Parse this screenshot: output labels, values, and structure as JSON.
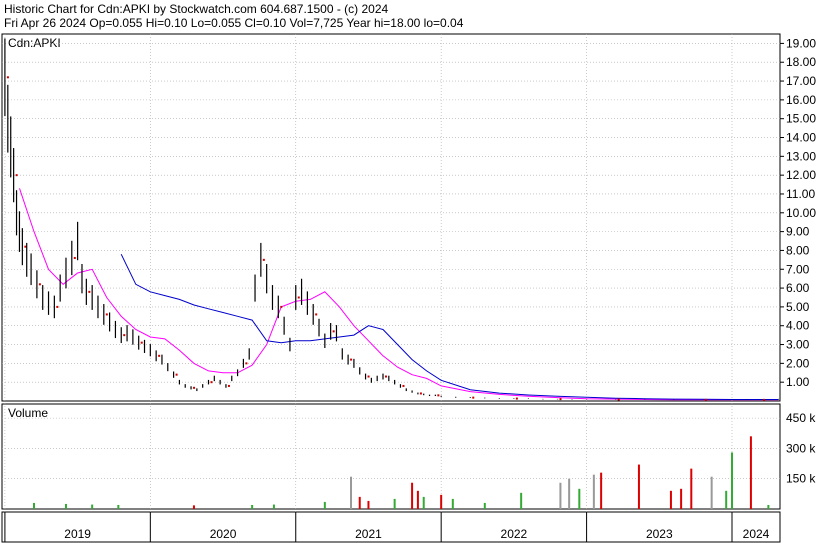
{
  "header": {
    "title_line": "Historic Chart for Cdn:APKI by Stockwatch.com 604.687.1500 - (c) 2024",
    "quote_line": "Fri Apr 26 2024   Op=0.055  Hi=0.10  Lo=0.055  Cl=0.10  Vol=7,725  Year hi=18.00  lo=0.04"
  },
  "price_panel": {
    "symbol_label": "Cdn:APKI"
  },
  "volume_panel": {
    "label": "Volume"
  },
  "colors": {
    "price_bars": "#000000",
    "ma_short": "#ff00ff",
    "ma_long": "#0000cc",
    "dots": "#cc0000",
    "vol_up": "#33aa33",
    "vol_down": "#dd0000",
    "vol_neutral": "#999999",
    "grid": "#aaaaaa"
  },
  "chart_data": [
    {
      "type": "line",
      "name": "price",
      "x_ticks": [
        "2019",
        "2020",
        "2021",
        "2022",
        "2023",
        "2024"
      ],
      "y_ticks": [
        "1.00",
        "2.00",
        "3.00",
        "4.00",
        "5.00",
        "6.00",
        "7.00",
        "8.00",
        "9.00",
        "10.00",
        "11.00",
        "12.00",
        "13.00",
        "14.00",
        "15.00",
        "16.00",
        "17.00",
        "18.00",
        "19.00"
      ],
      "ylim": [
        0,
        19.5
      ],
      "xlim": [
        2018.98,
        2024.33
      ],
      "series": [
        {
          "role": "price",
          "x": [
            2019.0,
            2019.02,
            2019.04,
            2019.06,
            2019.08,
            2019.1,
            2019.12,
            2019.15,
            2019.18,
            2019.22,
            2019.26,
            2019.3,
            2019.34,
            2019.38,
            2019.42,
            2019.46,
            2019.5,
            2019.53,
            2019.56,
            2019.6,
            2019.64,
            2019.68,
            2019.72,
            2019.76,
            2019.8,
            2019.84,
            2019.88,
            2019.92,
            2019.96,
            2020.0,
            2020.04,
            2020.08,
            2020.12,
            2020.16,
            2020.2,
            2020.24,
            2020.28,
            2020.32,
            2020.36,
            2020.4,
            2020.44,
            2020.48,
            2020.52,
            2020.56,
            2020.6,
            2020.64,
            2020.68,
            2020.72,
            2020.76,
            2020.8,
            2020.84,
            2020.88,
            2020.92,
            2020.96,
            2021.0,
            2021.04,
            2021.08,
            2021.12,
            2021.16,
            2021.2,
            2021.24,
            2021.28,
            2021.32,
            2021.36,
            2021.4,
            2021.44,
            2021.48,
            2021.52,
            2021.56,
            2021.6,
            2021.64,
            2021.68,
            2021.72,
            2021.76,
            2021.8,
            2021.84,
            2021.88,
            2021.92,
            2021.96,
            2022.0,
            2022.1,
            2022.2,
            2022.3,
            2022.4,
            2022.5,
            2022.6,
            2022.7,
            2022.8,
            2022.9,
            2023.0,
            2023.2,
            2023.4,
            2023.6,
            2023.8,
            2024.0,
            2024.1,
            2024.2,
            2024.32
          ],
          "y": [
            17.2,
            15.0,
            13.5,
            12.0,
            10.0,
            9.0,
            8.2,
            7.5,
            7.0,
            6.2,
            5.5,
            5.2,
            5.0,
            6.0,
            6.8,
            7.6,
            8.5,
            6.5,
            5.8,
            5.5,
            5.0,
            4.6,
            4.2,
            3.8,
            3.5,
            3.6,
            3.4,
            3.1,
            2.9,
            2.7,
            2.4,
            2.2,
            1.8,
            1.4,
            1.0,
            0.8,
            0.7,
            0.6,
            0.8,
            1.0,
            1.2,
            1.0,
            0.8,
            1.2,
            1.5,
            2.0,
            2.5,
            6.0,
            7.5,
            6.5,
            5.5,
            5.0,
            4.0,
            3.0,
            5.5,
            5.8,
            5.2,
            4.6,
            3.9,
            3.2,
            3.7,
            3.6,
            2.5,
            2.2,
            2.0,
            1.6,
            1.3,
            1.1,
            1.2,
            1.3,
            1.2,
            1.0,
            0.8,
            0.6,
            0.5,
            0.4,
            0.35,
            0.3,
            0.3,
            0.25,
            0.2,
            0.18,
            0.16,
            0.14,
            0.13,
            0.12,
            0.1,
            0.1,
            0.09,
            0.08,
            0.08,
            0.07,
            0.06,
            0.06,
            0.07,
            0.08,
            0.06,
            0.1
          ]
        },
        {
          "role": "ma_short",
          "x": [
            2019.1,
            2019.2,
            2019.3,
            2019.4,
            2019.5,
            2019.6,
            2019.7,
            2019.8,
            2019.9,
            2020.0,
            2020.1,
            2020.2,
            2020.3,
            2020.4,
            2020.5,
            2020.6,
            2020.7,
            2020.8,
            2020.9,
            2021.0,
            2021.1,
            2021.2,
            2021.3,
            2021.4,
            2021.5,
            2021.6,
            2021.7,
            2021.8,
            2021.9,
            2022.0,
            2022.2,
            2022.4,
            2022.6,
            2022.8,
            2023.0,
            2023.2,
            2023.4,
            2023.6,
            2023.8,
            2024.0,
            2024.2,
            2024.32
          ],
          "y": [
            11.3,
            9.0,
            7.0,
            6.2,
            6.8,
            7.0,
            5.5,
            4.5,
            3.8,
            3.4,
            3.3,
            2.7,
            2.0,
            1.6,
            1.5,
            1.5,
            1.9,
            3.0,
            5.0,
            5.3,
            5.4,
            5.8,
            5.0,
            4.0,
            3.2,
            2.4,
            1.8,
            1.4,
            1.2,
            0.8,
            0.5,
            0.35,
            0.25,
            0.18,
            0.12,
            0.1,
            0.08,
            0.07,
            0.07,
            0.07,
            0.07,
            0.07
          ]
        },
        {
          "role": "ma_long",
          "x": [
            2019.8,
            2019.9,
            2020.0,
            2020.1,
            2020.2,
            2020.3,
            2020.4,
            2020.5,
            2020.6,
            2020.7,
            2020.8,
            2020.9,
            2021.0,
            2021.1,
            2021.2,
            2021.3,
            2021.4,
            2021.5,
            2021.6,
            2021.7,
            2021.8,
            2021.9,
            2022.0,
            2022.2,
            2022.4,
            2022.6,
            2022.8,
            2023.0,
            2023.2,
            2023.4,
            2023.6,
            2023.8,
            2024.0,
            2024.2,
            2024.32
          ],
          "y": [
            7.8,
            6.2,
            5.8,
            5.6,
            5.4,
            5.1,
            4.9,
            4.7,
            4.5,
            4.3,
            3.2,
            3.1,
            3.2,
            3.2,
            3.3,
            3.4,
            3.5,
            4.0,
            3.8,
            3.0,
            2.2,
            1.6,
            1.1,
            0.6,
            0.42,
            0.32,
            0.25,
            0.2,
            0.15,
            0.12,
            0.1,
            0.09,
            0.08,
            0.08,
            0.08
          ]
        }
      ]
    },
    {
      "type": "bar",
      "name": "volume",
      "y_ticks": [
        "150 k",
        "300 k",
        "450 k"
      ],
      "ylim": [
        0,
        520
      ],
      "bars": [
        {
          "x": 2019.2,
          "v": 30,
          "c": "up"
        },
        {
          "x": 2019.42,
          "v": 25,
          "c": "up"
        },
        {
          "x": 2019.6,
          "v": 22,
          "c": "up"
        },
        {
          "x": 2019.78,
          "v": 20,
          "c": "up"
        },
        {
          "x": 2020.3,
          "v": 18,
          "c": "down"
        },
        {
          "x": 2020.7,
          "v": 20,
          "c": "up"
        },
        {
          "x": 2020.85,
          "v": 22,
          "c": "up"
        },
        {
          "x": 2021.2,
          "v": 35,
          "c": "up"
        },
        {
          "x": 2021.38,
          "v": 160,
          "c": "neutral"
        },
        {
          "x": 2021.44,
          "v": 60,
          "c": "down"
        },
        {
          "x": 2021.5,
          "v": 40,
          "c": "down"
        },
        {
          "x": 2021.68,
          "v": 50,
          "c": "up"
        },
        {
          "x": 2021.8,
          "v": 130,
          "c": "down"
        },
        {
          "x": 2021.84,
          "v": 90,
          "c": "down"
        },
        {
          "x": 2021.88,
          "v": 60,
          "c": "up"
        },
        {
          "x": 2022.0,
          "v": 70,
          "c": "down"
        },
        {
          "x": 2022.08,
          "v": 50,
          "c": "up"
        },
        {
          "x": 2022.3,
          "v": 30,
          "c": "up"
        },
        {
          "x": 2022.55,
          "v": 80,
          "c": "up"
        },
        {
          "x": 2022.82,
          "v": 130,
          "c": "neutral"
        },
        {
          "x": 2022.88,
          "v": 150,
          "c": "neutral"
        },
        {
          "x": 2022.95,
          "v": 100,
          "c": "up"
        },
        {
          "x": 2023.05,
          "v": 170,
          "c": "neutral"
        },
        {
          "x": 2023.1,
          "v": 180,
          "c": "down"
        },
        {
          "x": 2023.36,
          "v": 220,
          "c": "down"
        },
        {
          "x": 2023.58,
          "v": 90,
          "c": "down"
        },
        {
          "x": 2023.65,
          "v": 100,
          "c": "down"
        },
        {
          "x": 2023.72,
          "v": 200,
          "c": "down"
        },
        {
          "x": 2023.86,
          "v": 160,
          "c": "neutral"
        },
        {
          "x": 2023.96,
          "v": 90,
          "c": "up"
        },
        {
          "x": 2024.0,
          "v": 280,
          "c": "up"
        },
        {
          "x": 2024.13,
          "v": 360,
          "c": "down"
        },
        {
          "x": 2024.25,
          "v": 20,
          "c": "up"
        }
      ]
    }
  ]
}
